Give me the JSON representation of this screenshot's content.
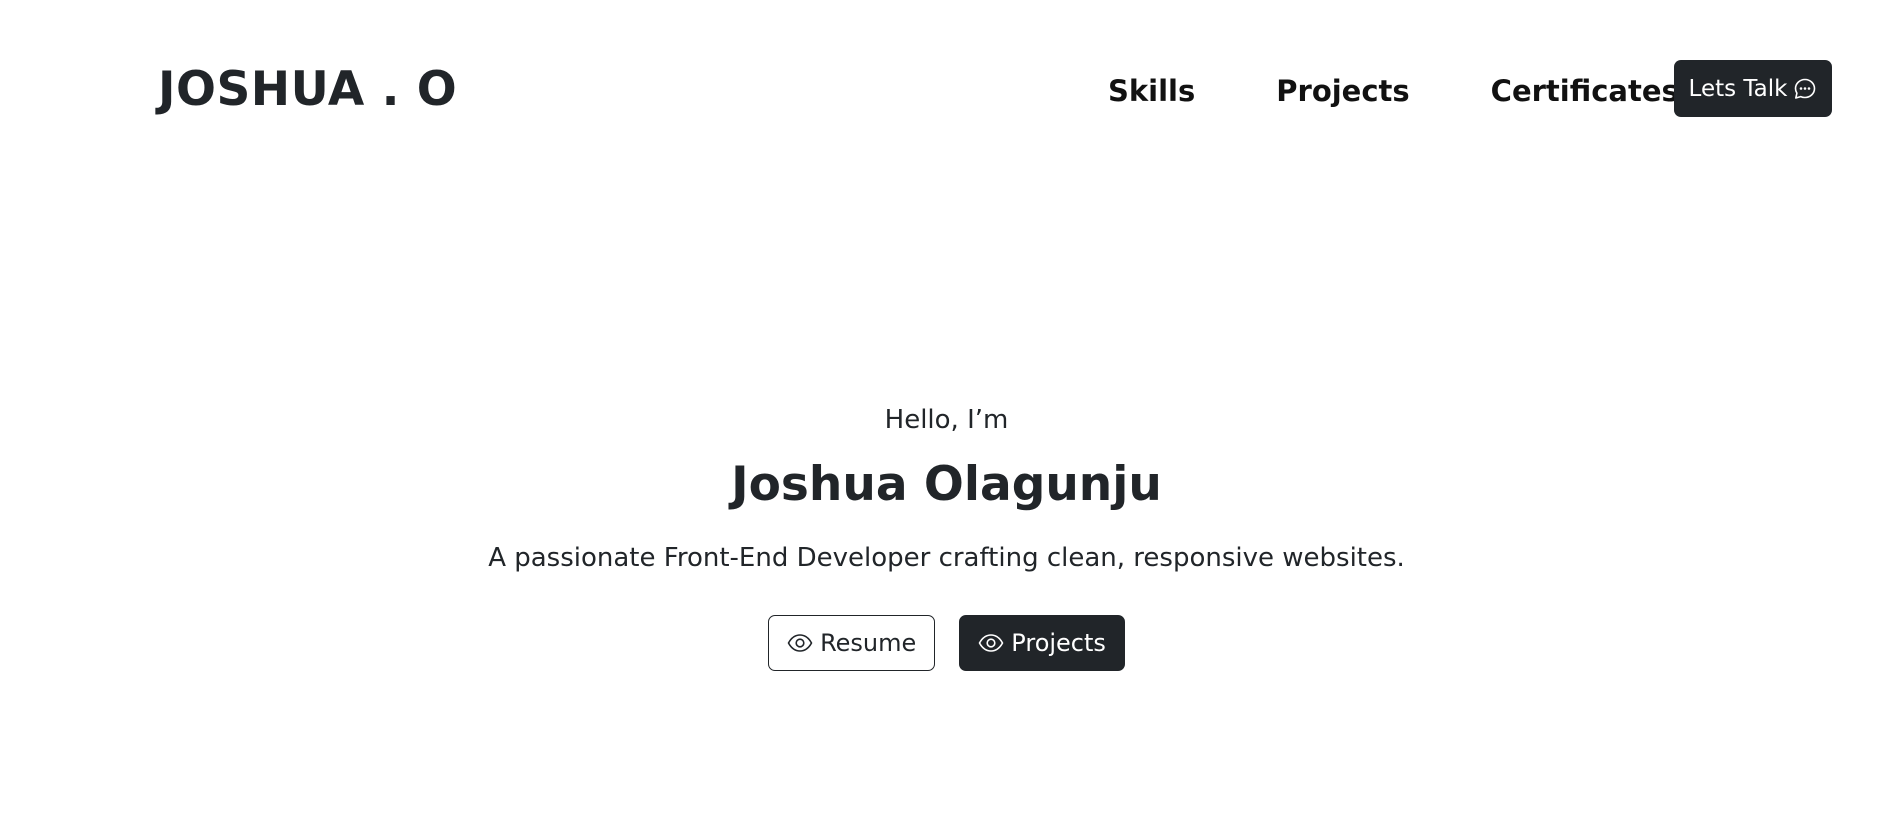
{
  "nav": {
    "brand": "JOSHUA . O",
    "links": [
      "Skills",
      "Projects",
      "Certificates"
    ],
    "cta_label": "Lets Talk",
    "cta_icon": "chat-dots-icon"
  },
  "hero": {
    "greeting": "Hello, I’m",
    "name": "Joshua Olagunju",
    "tagline": "A passionate Front-End Developer crafting clean, responsive websites.",
    "buttons": [
      {
        "label": "Resume",
        "icon": "eye-icon",
        "style": "outline"
      },
      {
        "label": "Projects",
        "icon": "eye-icon",
        "style": "dark"
      }
    ]
  },
  "colors": {
    "text": "#212529",
    "dark_button": "#212529",
    "background": "#ffffff"
  }
}
